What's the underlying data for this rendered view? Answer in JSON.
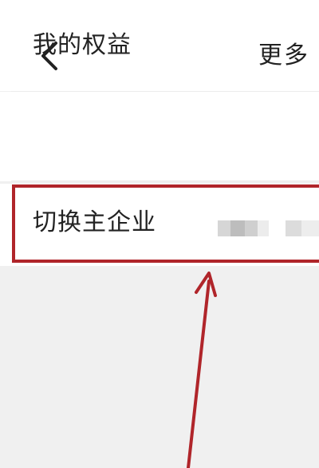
{
  "nav": {
    "title": "更多",
    "back_icon": "chevron-left-icon"
  },
  "rows": [
    {
      "label": "我的权益"
    },
    {
      "label": "切换主企业",
      "value_obscured": true
    }
  ],
  "colors": {
    "highlight": "#b0252a",
    "arrow": "#b0252a",
    "background": "#f0f0f0"
  }
}
